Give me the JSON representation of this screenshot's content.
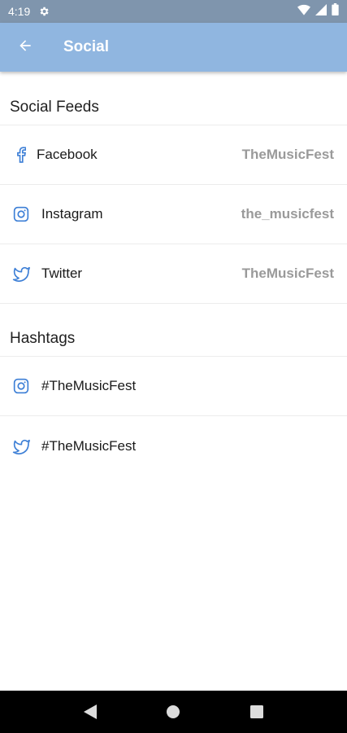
{
  "status_bar": {
    "time": "4:19",
    "icons": [
      "gear-icon",
      "wifi-icon",
      "signal-icon",
      "battery-icon"
    ]
  },
  "app_bar": {
    "title": "Social",
    "background": "#90b6e0",
    "back_icon": "arrow-back-icon"
  },
  "sections": {
    "social_feeds": {
      "title": "Social Feeds",
      "items": [
        {
          "icon": "facebook-icon",
          "label": "Facebook",
          "value": "TheMusicFest"
        },
        {
          "icon": "instagram-icon",
          "label": "Instagram",
          "value": "the_musicfest"
        },
        {
          "icon": "twitter-icon",
          "label": "Twitter",
          "value": "TheMusicFest"
        }
      ]
    },
    "hashtags": {
      "title": "Hashtags",
      "items": [
        {
          "icon": "instagram-icon",
          "label": "#TheMusicFest"
        },
        {
          "icon": "twitter-icon",
          "label": "#TheMusicFest"
        }
      ]
    }
  },
  "colors": {
    "accent_icon": "#3d7fd6",
    "value_text": "#9a9a9a",
    "status_bar": "#7f95ad"
  },
  "nav_bar": {
    "icons": [
      "back-triangle-icon",
      "home-circle-icon",
      "recents-square-icon"
    ]
  }
}
